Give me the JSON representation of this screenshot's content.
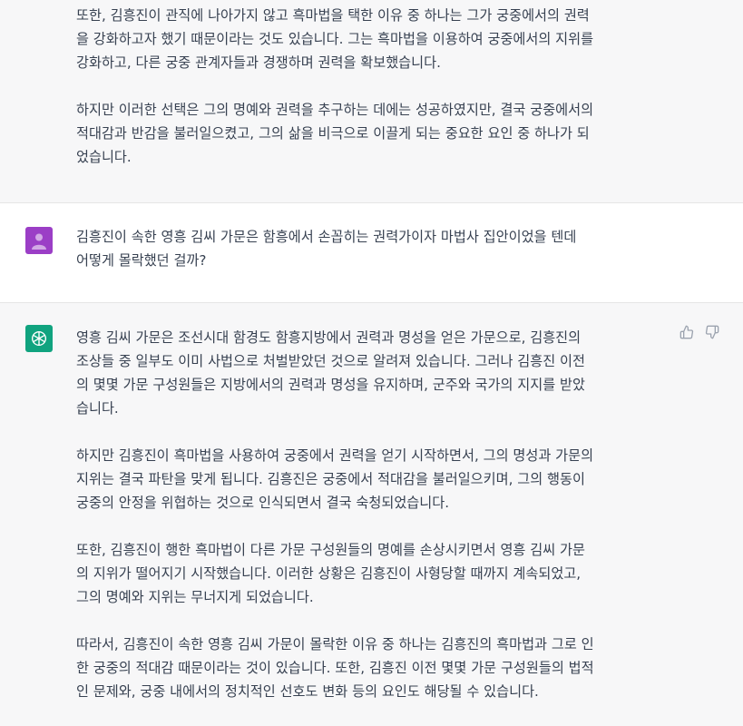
{
  "conversation": {
    "prev_assistant": {
      "paragraphs": [
        "또한, 김흥진이 관직에 나아가지 않고 흑마법을 택한 이유 중 하나는 그가 궁중에서의 권력\n을 강화하고자 했기 때문이라는 것도 있습니다. 그는 흑마법을 이용하여 궁중에서의 지위를\n강화하고, 다른 궁중 관계자들과 경쟁하며 권력을 확보했습니다.",
        "하지만 이러한 선택은 그의 명예와 권력을 추구하는 데에는 성공하였지만, 결국 궁중에서의\n적대감과 반감을 불러일으켰고, 그의 삶을 비극으로 이끌게 되는 중요한 요인 중 하나가 되\n었습니다."
      ]
    },
    "user_message": {
      "text": "김흥진이 속한 영흥 김씨 가문은 함흥에서 손꼽히는 권력가이자 마법사 집안이었을 텐데\n어떻게 몰락했던 걸까?"
    },
    "assistant_reply": {
      "paragraphs": [
        "영흥 김씨 가문은 조선시대 함경도 함흥지방에서 권력과 명성을 얻은 가문으로, 김흥진의\n조상들 중 일부도 이미 사법으로 처벌받았던 것으로 알려져 있습니다. 그러나 김흥진 이전\n의 몇몇 가문 구성원들은 지방에서의 권력과 명성을 유지하며, 군주와 국가의 지지를 받았\n습니다.",
        "하지만 김흥진이 흑마법을 사용하여 궁중에서 권력을 얻기 시작하면서, 그의 명성과 가문의\n지위는 결국 파탄을 맞게 됩니다. 김흥진은 궁중에서 적대감을 불러일으키며, 그의 행동이\n궁중의 안정을 위협하는 것으로 인식되면서 결국 숙청되었습니다.",
        "또한, 김흥진이 행한 흑마법이 다른 가문 구성원들의 명예를 손상시키면서 영흥 김씨 가문\n의 지위가 떨어지기 시작했습니다. 이러한 상황은 김흥진이 사형당할 때까지 계속되었고,\n그의 명예와 지위는 무너지게 되었습니다.",
        "따라서, 김흥진이 속한 영흥 김씨 가문이 몰락한 이유 중 하나는 김흥진의 흑마법과 그로 인\n한 궁중의 적대감 때문이라는 것이 있습니다. 또한, 김흥진 이전 몇몇 가문 구성원들의 법적\n인 문제와, 궁중 내에서의 정치적인 선호도 변화 등의 요인도 해당될 수 있습니다."
      ],
      "actions": [
        "thumbs-up-icon",
        "thumbs-down-icon"
      ]
    }
  },
  "colors": {
    "user_avatar": "#9b3ec6",
    "assistant_avatar": "#10a37f",
    "assistant_bg": "#f7f7f8"
  }
}
